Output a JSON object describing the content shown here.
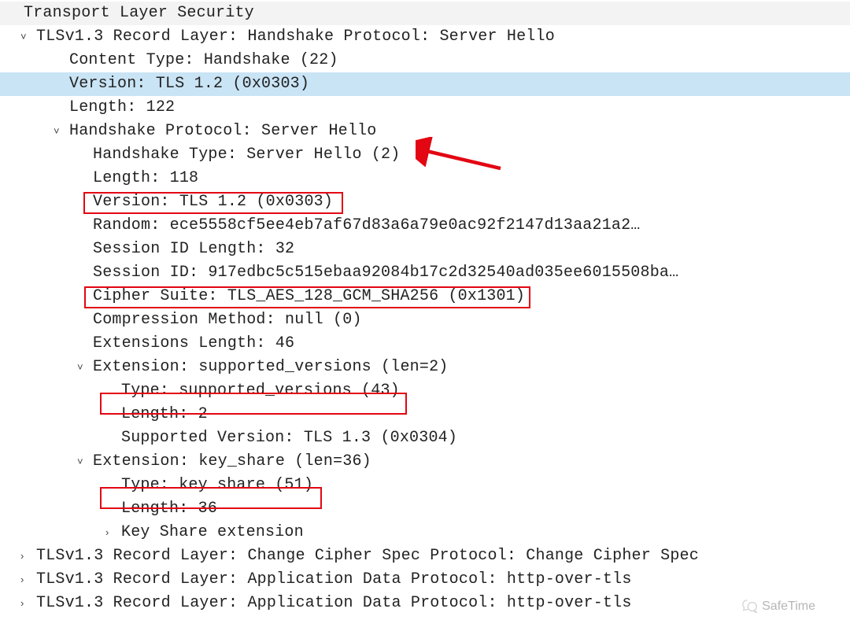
{
  "title": "Transport Layer Security",
  "record1": {
    "header": "TLSv1.3 Record Layer: Handshake Protocol: Server Hello",
    "content_type": "Content Type: Handshake (22)",
    "record_version": "Version: TLS 1.2 (0x0303)",
    "length": "Length: 122",
    "handshake": {
      "header": "Handshake Protocol: Server Hello",
      "type": "Handshake Type: Server Hello (2)",
      "length": "Length: 118",
      "version": "Version: TLS 1.2 (0x0303)",
      "random": "Random: ece5558cf5ee4eb7af67d83a6a79e0ac92f2147d13aa21a2…",
      "session_id_length": "Session ID Length: 32",
      "session_id": "Session ID: 917edbc5c515ebaa92084b17c2d32540ad035ee6015508ba…",
      "cipher_suite": "Cipher Suite: TLS_AES_128_GCM_SHA256 (0x1301)",
      "compression": "Compression Method: null (0)",
      "ext_length": "Extensions Length: 46",
      "ext_sv": {
        "header": "Extension: supported_versions (len=2)",
        "type": "Type: supported_versions (43)",
        "length": "Length: 2",
        "value": "Supported Version: TLS 1.3 (0x0304)"
      },
      "ext_ks": {
        "header": "Extension: key_share (len=36)",
        "type": "Type: key share (51)",
        "length": "Length: 36",
        "sub": "Key Share extension"
      }
    }
  },
  "record2": "TLSv1.3 Record Layer: Change Cipher Spec Protocol: Change Cipher Spec",
  "record3": "TLSv1.3 Record Layer: Application Data Protocol: http-over-tls",
  "record4": "TLSv1.3 Record Layer: Application Data Protocol: http-over-tls",
  "watermark": "SafeTime",
  "colors": {
    "highlight": "#c9e4f5",
    "annotation": "#e30613"
  }
}
